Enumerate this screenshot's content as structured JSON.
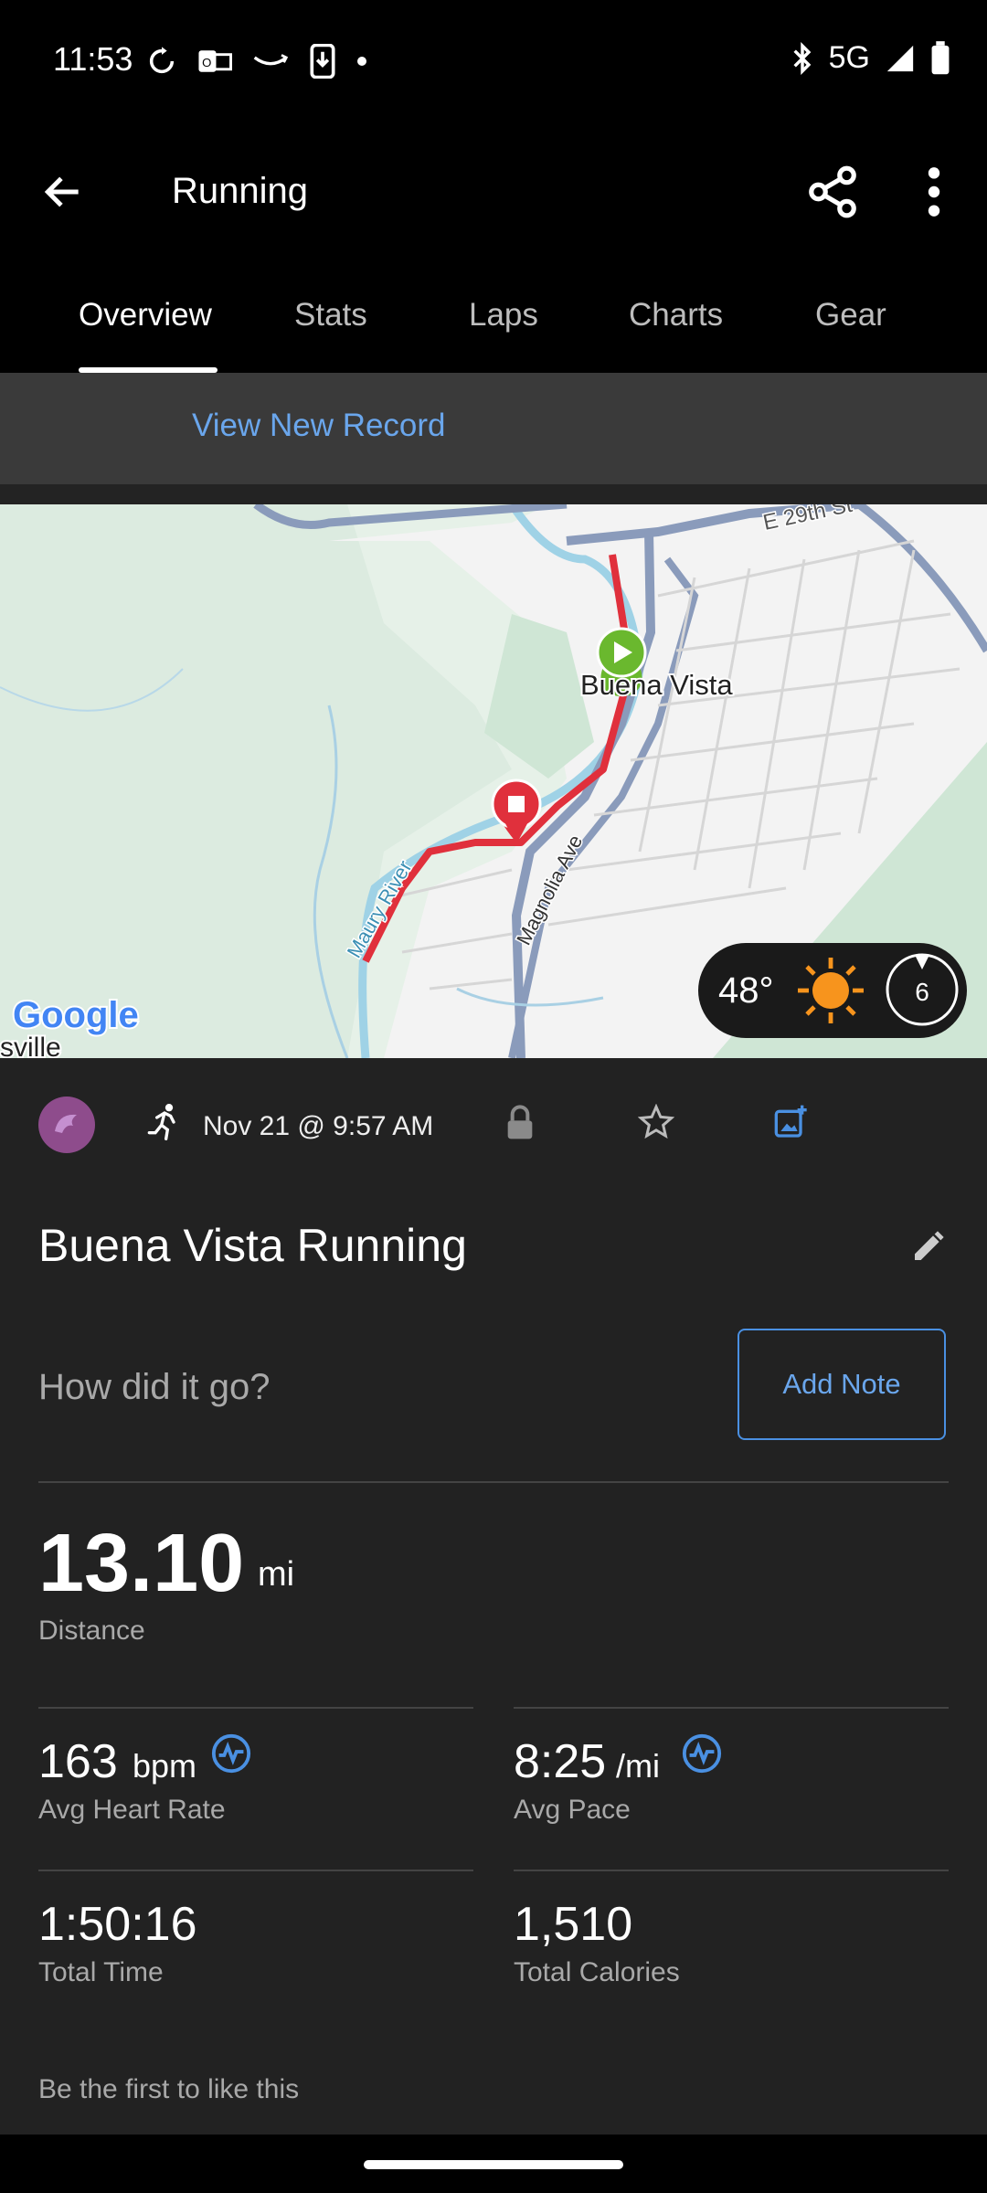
{
  "status_bar": {
    "time": "11:53",
    "network": "5G"
  },
  "app_bar": {
    "title": "Running"
  },
  "tabs": [
    {
      "label": "Overview"
    },
    {
      "label": "Stats"
    },
    {
      "label": "Laps"
    },
    {
      "label": "Charts"
    },
    {
      "label": "Gear"
    }
  ],
  "active_tab": "Overview",
  "banner": {
    "link": "View New Record"
  },
  "map": {
    "place_label": "Buena Vista",
    "street_label_1": "E 29th St",
    "street_label_2": "Magnolia Ave",
    "river_label": "Maury River",
    "partial_town_label": "sville",
    "provider_logo": "Google",
    "weather": {
      "temp": "48°",
      "wind": "6"
    }
  },
  "activity": {
    "date": "Nov 21 @ 9:57 AM",
    "title": "Buena Vista Running",
    "note_prompt": "How did it go?",
    "add_note_label": "Add Note",
    "distance": {
      "value": "13.10",
      "unit": "mi",
      "label": "Distance"
    },
    "heart_rate": {
      "value": "163",
      "unit": "bpm",
      "label": "Avg Heart Rate"
    },
    "pace": {
      "value": "8:25",
      "unit": "/mi",
      "label": "Avg Pace"
    },
    "total_time": {
      "value": "1:50:16",
      "label": "Total Time"
    },
    "calories": {
      "value": "1,510",
      "label": "Total Calories"
    },
    "likes_text": "Be the first to like this"
  },
  "colors": {
    "accent": "#6aa6ec",
    "route": "#e0303c",
    "start_marker": "#6ab82e",
    "content_bg": "#222222"
  }
}
